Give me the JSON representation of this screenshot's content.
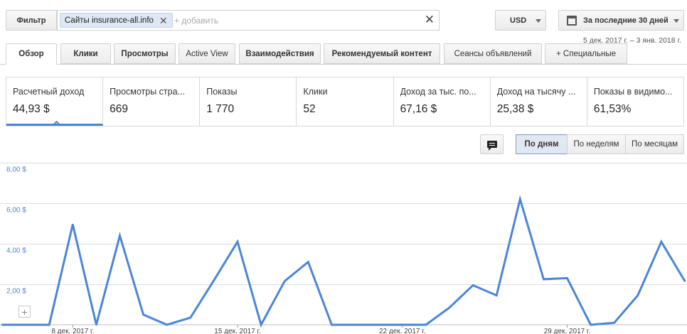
{
  "toolbar": {
    "filter_label": "Фильтр",
    "filter_chip": "Сайты insurance-all.info",
    "add_placeholder": "+ добавить",
    "currency": "USD",
    "date_preset": "За последние 30 дней",
    "date_range": "5 дек. 2017 г. – 3 янв. 2018 г."
  },
  "tabs": [
    {
      "label": "Обзор",
      "active": true
    },
    {
      "label": "Клики"
    },
    {
      "label": "Просмотры"
    },
    {
      "label": "Active View"
    },
    {
      "label": "Взаимодействия"
    },
    {
      "label": "Рекомендуемый контент"
    },
    {
      "label": "Сеансы объявлений"
    },
    {
      "label": "+ Специальные"
    }
  ],
  "metrics": [
    {
      "label": "Расчетный доход",
      "value": "44,93 $",
      "selected": true
    },
    {
      "label": "Просмотры стра...",
      "value": "669"
    },
    {
      "label": "Показы",
      "value": "1 770"
    },
    {
      "label": "Клики",
      "value": "52"
    },
    {
      "label": "Доход за тыс. по...",
      "value": "67,16 $"
    },
    {
      "label": "Доход на тысячу ...",
      "value": "25,38 $"
    },
    {
      "label": "Показы в видимо...",
      "value": "61,53%"
    }
  ],
  "granularity": {
    "by_day": "По дням",
    "by_week": "По неделям",
    "by_month": "По месяцам",
    "active": "by_day"
  },
  "colors": {
    "line": "#4a86d8",
    "accent": "#4a86d8"
  },
  "icons": {
    "annotation": "comment-icon",
    "calendar": "calendar-icon",
    "zoom": "plus-icon"
  },
  "chart_data": {
    "type": "line",
    "grid": true,
    "ylim": [
      0,
      8
    ],
    "y_ticks": [
      2,
      4,
      6,
      8
    ],
    "y_tick_labels": [
      "2,00 $",
      "4,00 $",
      "6,00 $",
      "8,00 $"
    ],
    "x_ticks": [
      "2017-12-08",
      "2017-12-15",
      "2017-12-22",
      "2017-12-29"
    ],
    "x_tick_labels": [
      "8 дек. 2017 г.",
      "15 дек. 2017 г.",
      "22 дек. 2017 г.",
      "29 дек. 2017 г."
    ],
    "x": [
      "2017-12-05",
      "2017-12-06",
      "2017-12-07",
      "2017-12-08",
      "2017-12-09",
      "2017-12-10",
      "2017-12-11",
      "2017-12-12",
      "2017-12-13",
      "2017-12-14",
      "2017-12-15",
      "2017-12-16",
      "2017-12-17",
      "2017-12-18",
      "2017-12-19",
      "2017-12-20",
      "2017-12-21",
      "2017-12-22",
      "2017-12-23",
      "2017-12-24",
      "2017-12-25",
      "2017-12-26",
      "2017-12-27",
      "2017-12-28",
      "2017-12-29",
      "2017-12-30",
      "2017-12-31",
      "2018-01-01",
      "2018-01-02",
      "2018-01-03"
    ],
    "series": [
      {
        "values": [
          0,
          0,
          0,
          4.95,
          0,
          4.4,
          0.5,
          0,
          0.35,
          2.2,
          4.1,
          0,
          2.15,
          3.1,
          0,
          0,
          0,
          0,
          0,
          0.85,
          1.95,
          1.45,
          6.2,
          2.25,
          2.3,
          0,
          0.1,
          1.45,
          4.1,
          2.15
        ]
      }
    ]
  }
}
